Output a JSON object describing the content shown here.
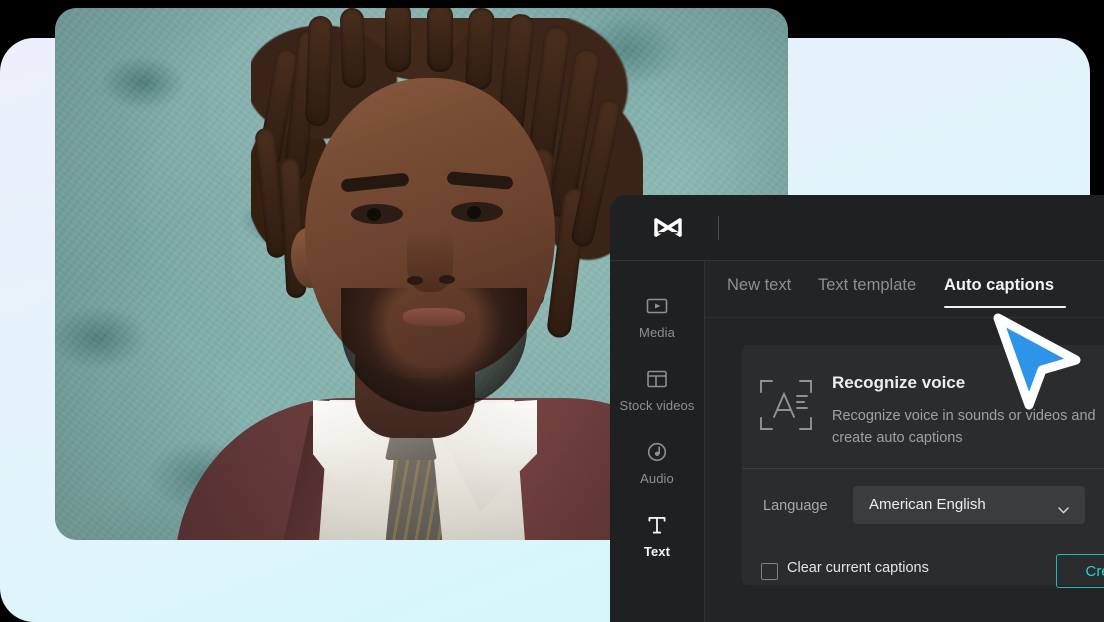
{
  "app": {
    "name": "CapCut",
    "logo_icon": "capcut-logo-icon"
  },
  "sidebar": {
    "items": [
      {
        "label": "Media",
        "icon": "media-icon",
        "active": false
      },
      {
        "label": "Stock videos",
        "icon": "stock-videos-icon",
        "active": false
      },
      {
        "label": "Audio",
        "icon": "audio-icon",
        "active": false
      },
      {
        "label": "Text",
        "icon": "text-icon",
        "active": true
      }
    ]
  },
  "tabs": [
    {
      "label": "New text",
      "active": false
    },
    {
      "label": "Text template",
      "active": false
    },
    {
      "label": "Auto captions",
      "active": true
    }
  ],
  "recognize_voice": {
    "icon": "recognize-voice-icon",
    "title": "Recognize voice",
    "description": "Recognize voice in sounds or videos and create auto captions"
  },
  "language": {
    "label": "Language",
    "value": "American English",
    "chevron_icon": "chevron-down-icon"
  },
  "clear_captions": {
    "label": "Clear current captions",
    "checked": false
  },
  "create_button": {
    "label": "Create"
  },
  "cursor": {
    "icon": "mouse-pointer-icon",
    "color": "#2d94e8"
  },
  "colors": {
    "accent_teal": "#2ad0cf",
    "panel_bg": "#232426",
    "panel_dark": "#1f2022",
    "card_bg": "#2b2c2e",
    "text_primary": "#eceded",
    "text_muted": "#8d8f92",
    "backdrop_top": "#eceffb",
    "backdrop_bottom": "#cdf8fb"
  },
  "photo": {
    "alt": "Man with dreadlocks in a maroon suit in front of a teal textured wall"
  }
}
